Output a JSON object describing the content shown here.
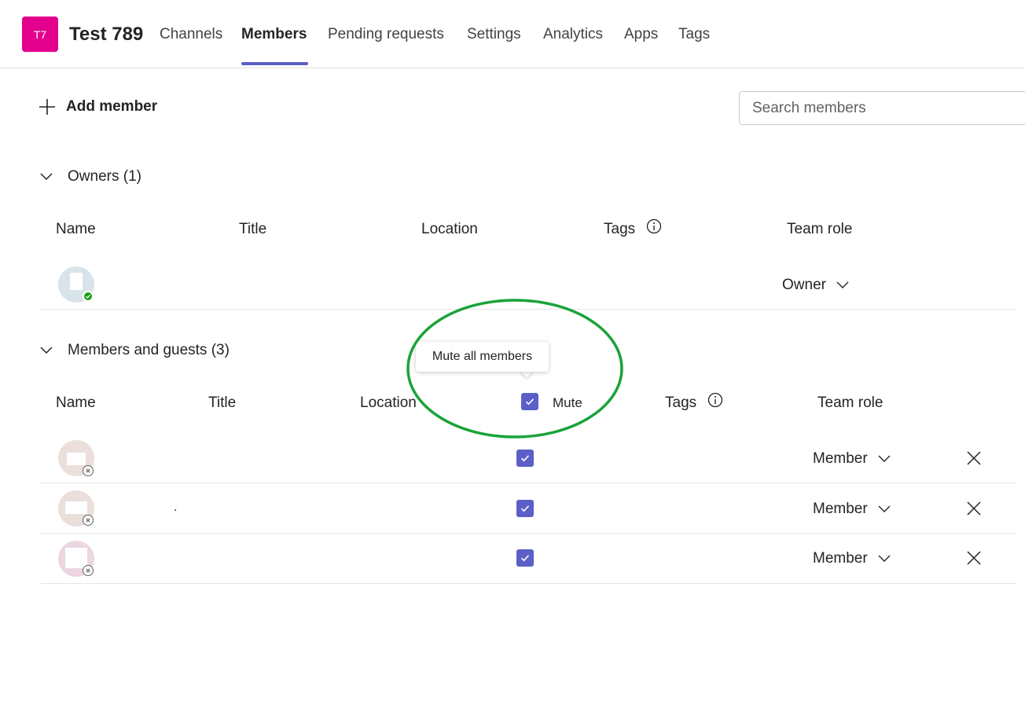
{
  "header": {
    "team_initials": "T7",
    "team_name": "Test 789",
    "tabs": [
      {
        "label": "Channels"
      },
      {
        "label": "Members"
      },
      {
        "label": "Pending requests"
      },
      {
        "label": "Settings"
      },
      {
        "label": "Analytics"
      },
      {
        "label": "Apps"
      },
      {
        "label": "Tags"
      }
    ],
    "active_tab": "Members"
  },
  "toolbar": {
    "add_member_label": "Add member",
    "search_placeholder": "Search members"
  },
  "owners": {
    "section_label": "Owners (1)",
    "columns": [
      "Name",
      "Title",
      "Location",
      "Tags",
      "Team role"
    ],
    "rows": [
      {
        "name": "",
        "role": "Owner",
        "presence": "available"
      }
    ]
  },
  "members": {
    "section_label": "Members and guests (3)",
    "columns": [
      "Name",
      "Title",
      "Location",
      "Mute",
      "Tags",
      "Team role"
    ],
    "mute_all_checked": true,
    "tooltip": "Mute all members",
    "rows": [
      {
        "name": "",
        "muted": true,
        "role": "Member",
        "presence": "offline"
      },
      {
        "name": ".",
        "muted": true,
        "role": "Member",
        "presence": "offline"
      },
      {
        "name": "",
        "muted": true,
        "role": "Member",
        "presence": "offline"
      }
    ]
  },
  "colors": {
    "accent": "#5b5fc7",
    "team_avatar": "#e3008c",
    "annotation_circle": "#1aa33a",
    "presence_available": "#13a10e"
  },
  "icons": {
    "add": "plus-icon",
    "collapse": "chevron-down-icon",
    "info": "info-icon",
    "remove": "close-icon",
    "check": "checkmark-icon"
  }
}
